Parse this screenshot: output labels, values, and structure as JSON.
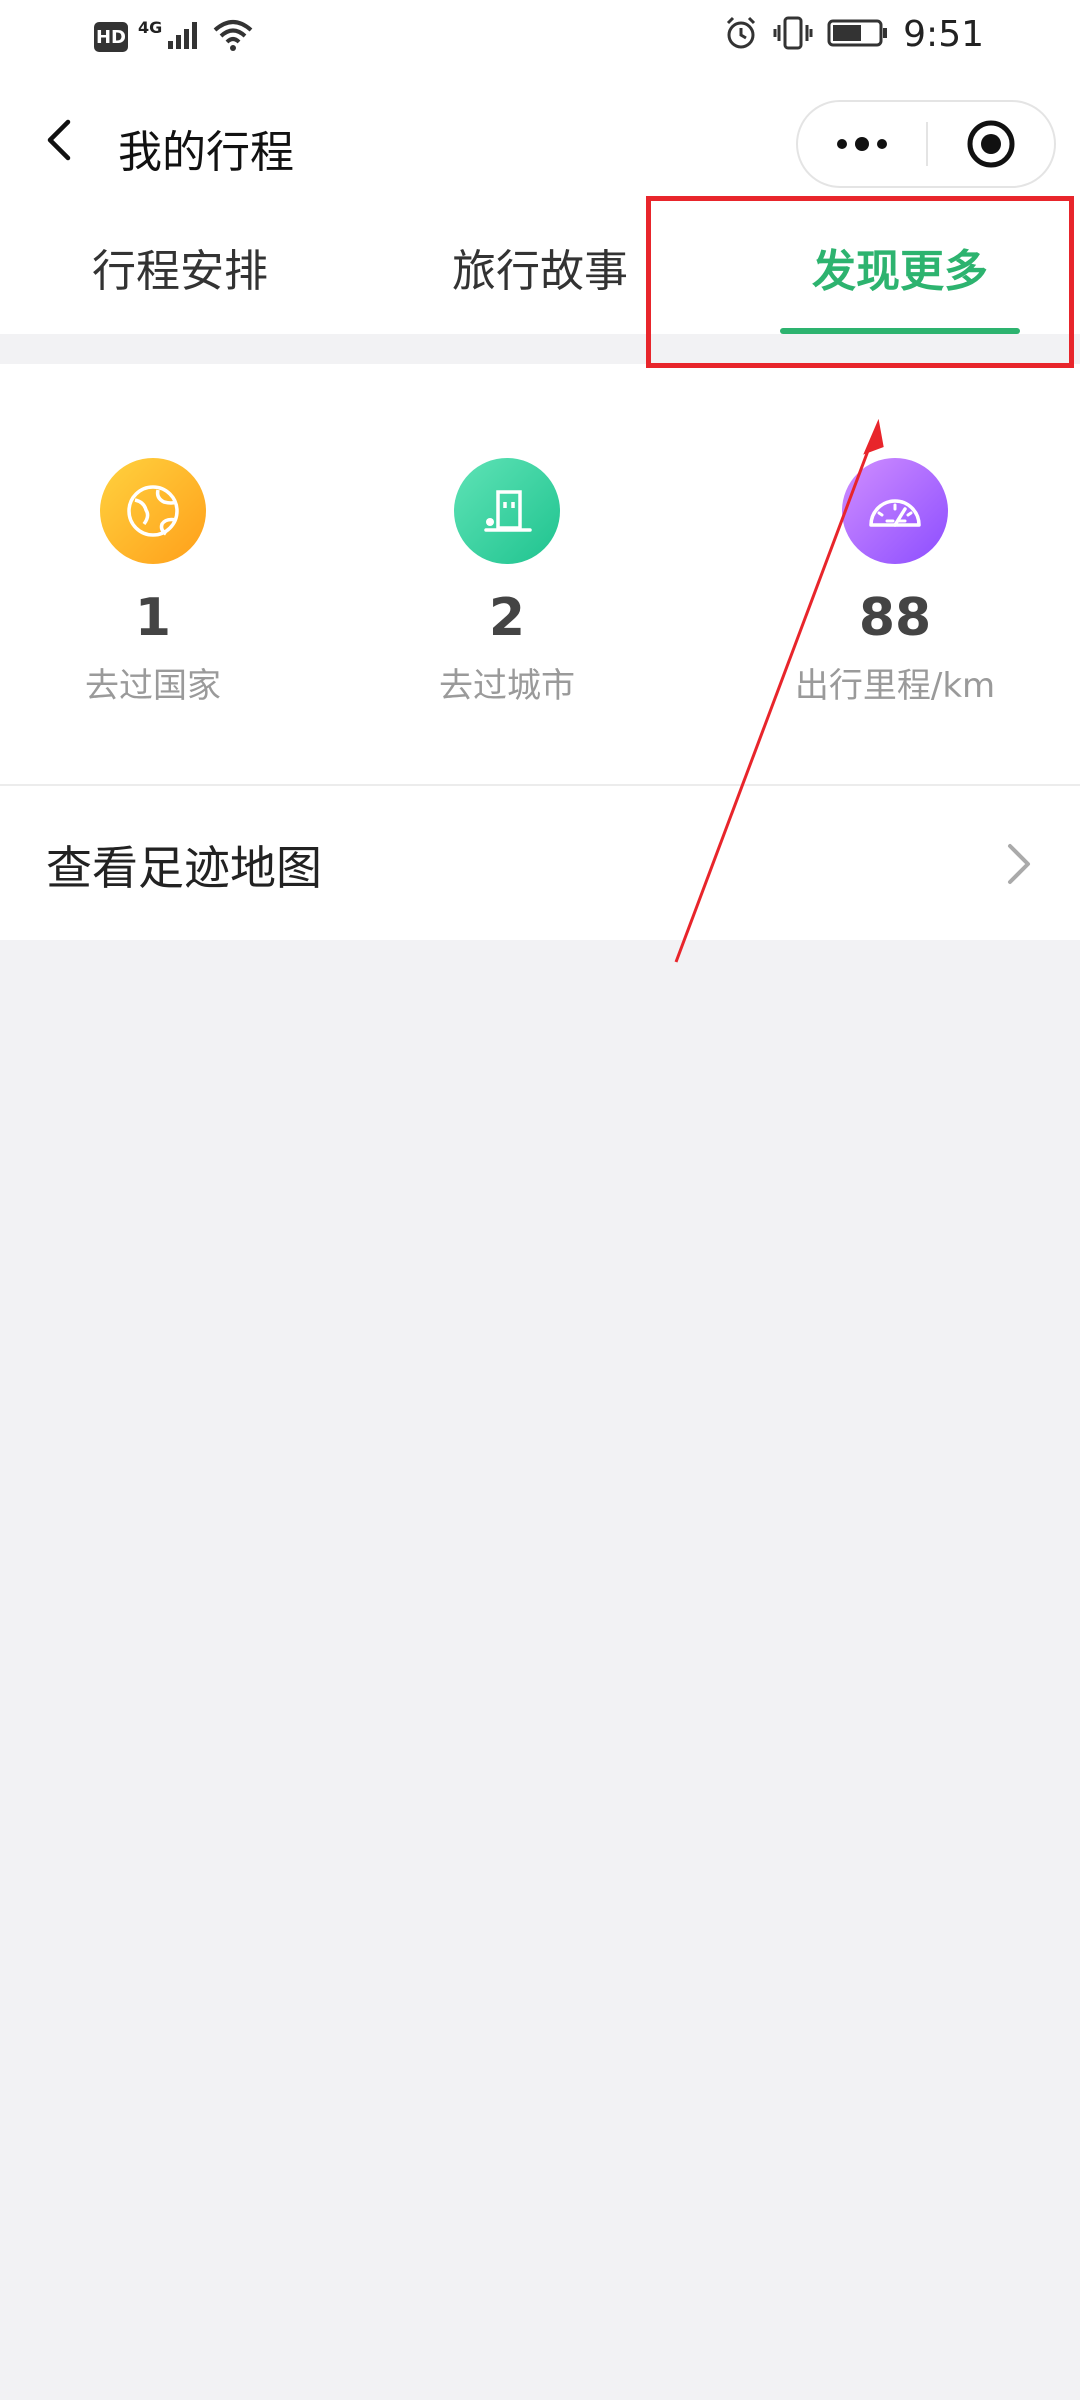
{
  "status_bar": {
    "network_hd": "HD",
    "network_type": "4G",
    "time": "9:51"
  },
  "header": {
    "title": "我的行程"
  },
  "tabs": [
    {
      "label": "行程安排",
      "active": false
    },
    {
      "label": "旅行故事",
      "active": false
    },
    {
      "label": "发现更多",
      "active": true
    }
  ],
  "stats": [
    {
      "value": "1",
      "label": "去过国家",
      "icon": "globe-icon",
      "color_from": "#ffcc33",
      "color_to": "#ff9f1a"
    },
    {
      "value": "2",
      "label": "去过城市",
      "icon": "building-icon",
      "color_from": "#55e0b0",
      "color_to": "#1fc38f"
    },
    {
      "value": "88",
      "label": "出行里程/km",
      "icon": "speedometer-icon",
      "color_from": "#c98bff",
      "color_to": "#8c4dff"
    }
  ],
  "footprint": {
    "label": "查看足迹地图"
  },
  "colors": {
    "accent": "#2db36f",
    "annotation": "#e8252b",
    "background": "#f2f2f4"
  }
}
